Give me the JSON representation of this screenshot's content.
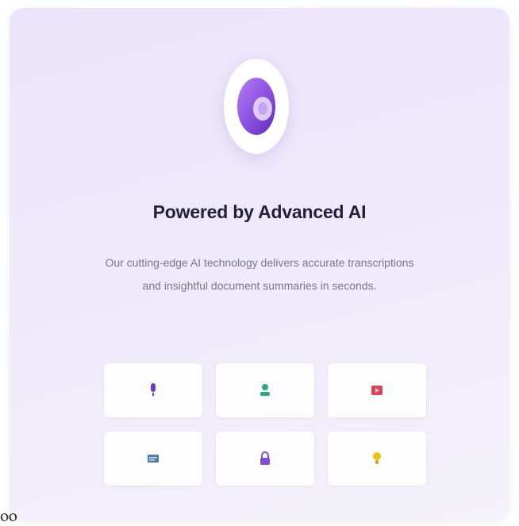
{
  "feature_card": {
    "title": "Powered by Advanced AI",
    "description": "Our cutting-edge AI technology delivers accurate transcriptions and insightful document summaries in seconds.",
    "logo_icon": "ai-orb-icon",
    "accent_color": "#8a4fe0"
  },
  "feature_icons": [
    {
      "name": "microphone-icon",
      "color": "#6a3fbf"
    },
    {
      "name": "user-icon",
      "color": "#2fa58a"
    },
    {
      "name": "video-icon",
      "color": "#d8455a"
    },
    {
      "name": "document-icon",
      "color": "#4f7fa8"
    },
    {
      "name": "lock-icon",
      "color": "#7b4fd0"
    },
    {
      "name": "lightbulb-icon",
      "color": "#e6c21a"
    }
  ]
}
